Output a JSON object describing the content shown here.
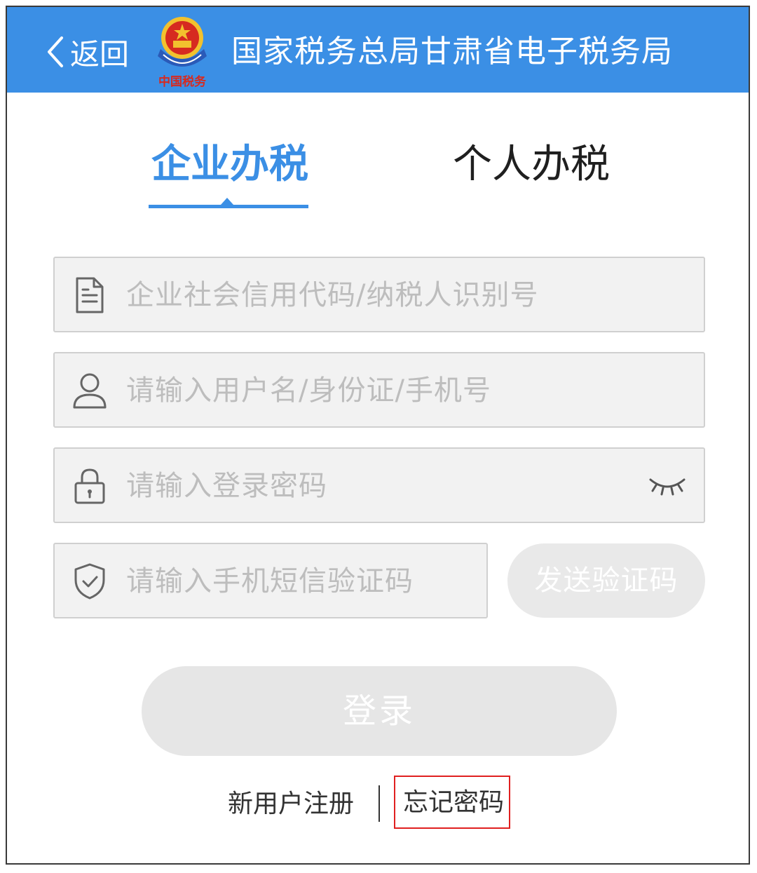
{
  "header": {
    "back_label": "返回",
    "logo_caption": "中国税务",
    "title": "国家税务总局甘肃省电子税务局",
    "background_color": "#3b8fe5"
  },
  "tabs": [
    {
      "label": "企业办税",
      "active": true
    },
    {
      "label": "个人办税",
      "active": false
    }
  ],
  "form": {
    "tax_id": {
      "placeholder": "企业社会信用代码/纳税人识别号",
      "icon": "document-icon"
    },
    "username": {
      "placeholder": "请输入用户名/身份证/手机号",
      "icon": "user-icon"
    },
    "password": {
      "placeholder": "请输入登录密码",
      "icon": "lock-icon",
      "toggle_icon": "eye-closed-icon"
    },
    "sms_code": {
      "placeholder": "请输入手机短信验证码",
      "icon": "shield-check-icon"
    },
    "send_code_label": "发送验证码",
    "login_label": "登录"
  },
  "footer": {
    "register_label": "新用户注册",
    "forgot_label": "忘记密码",
    "highlight_color": "#e02020"
  }
}
